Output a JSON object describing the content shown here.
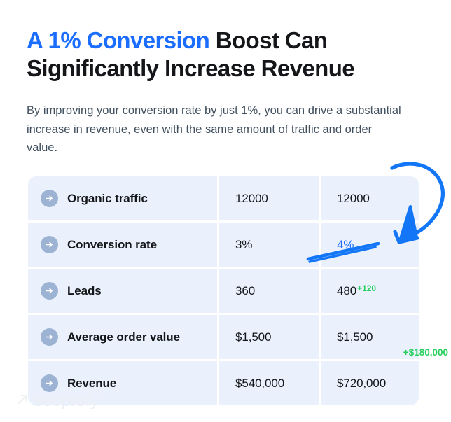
{
  "headline": {
    "accent": "A 1% Conversion",
    "rest": " Boost Can Significantly Increase Revenue"
  },
  "subtitle": "By improving your conversion rate by just 1%, you can drive a substantial increase in revenue, even with the same amount of traffic and order value.",
  "table": {
    "rows": [
      {
        "icon": "arrow-right-circle-icon",
        "label": "Organic traffic",
        "value1": "12000",
        "value2": "12000",
        "value2_accent": false,
        "delta_sup": "",
        "delta_float": ""
      },
      {
        "icon": "arrow-right-circle-icon",
        "label": "Conversion rate",
        "value1": "3%",
        "value2": "4%",
        "value2_accent": true,
        "delta_sup": "",
        "delta_float": ""
      },
      {
        "icon": "arrow-right-circle-icon",
        "label": "Leads",
        "value1": "360",
        "value2": "480",
        "value2_accent": false,
        "delta_sup": "+120",
        "delta_float": ""
      },
      {
        "icon": "arrow-right-circle-icon",
        "label": "Average order value",
        "value1": "$1,500",
        "value2": "$1,500",
        "value2_accent": false,
        "delta_sup": "",
        "delta_float": ""
      },
      {
        "icon": "arrow-right-circle-icon",
        "label": "Revenue",
        "value1": "$540,000",
        "value2": "$720,000",
        "value2_accent": false,
        "delta_sup": "",
        "delta_float": "+$180,000"
      }
    ]
  },
  "annotations": {
    "curved_arrow": "curved-arrow-doodle",
    "underline": "underline-doodle"
  },
  "logo": {
    "mark": "arrow-up-right-icon",
    "text": "seoprofy"
  },
  "colors": {
    "accent_blue": "#1a6dff",
    "green": "#25cf5d",
    "cell_bg": "#eaf1fd",
    "text_dark": "#141619",
    "text_muted": "#41505f",
    "icon_circle": "#9db3d3",
    "logo_gray": "#eceff4"
  }
}
